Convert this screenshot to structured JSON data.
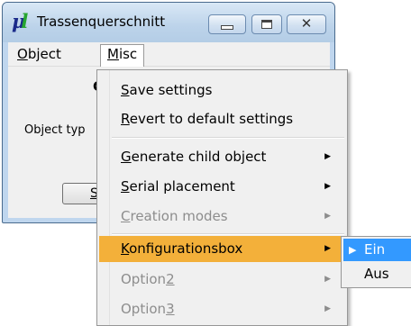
{
  "window": {
    "title": "Trassenquerschnitt",
    "controls": {
      "minimize_icon": "minimize-icon",
      "maximize_icon": "maximize-icon",
      "close_glyph": "✕"
    }
  },
  "menubar": {
    "items": [
      {
        "label": "Object"
      },
      {
        "label": "Misc"
      }
    ]
  },
  "client": {
    "partial_heading": "C",
    "object_type_label": "Object typ",
    "button_partial_label": "St"
  },
  "misc_menu": {
    "items": [
      {
        "label": "Save settings",
        "accel": "S",
        "has_submenu": false,
        "enabled": true
      },
      {
        "label": "Revert to default settings",
        "accel": "R",
        "has_submenu": false,
        "enabled": true
      },
      {
        "label": "Generate child object",
        "accel": "G",
        "has_submenu": true,
        "enabled": true
      },
      {
        "label": "Serial placement",
        "accel": "S",
        "has_submenu": true,
        "enabled": true
      },
      {
        "label": "Creation modes",
        "accel": "C",
        "has_submenu": true,
        "enabled": false
      },
      {
        "label": "Konfigurationsbox",
        "accel": "K",
        "has_submenu": true,
        "enabled": true,
        "highlighted": true
      },
      {
        "label": "Option2",
        "accel": "2",
        "has_submenu": true,
        "enabled": false
      },
      {
        "label": "Option3",
        "accel": "3",
        "has_submenu": true,
        "enabled": false
      }
    ],
    "arrow_glyph": "▶"
  },
  "submenu": {
    "items": [
      {
        "label": "Ein",
        "selected": true
      },
      {
        "label": "Aus",
        "selected": false
      }
    ],
    "selected_marker": "▶"
  },
  "colors": {
    "highlight": "#f3b03a",
    "submenu_active": "#3399ff",
    "disabled_text": "#8d8d8d",
    "window_frame": "#bfd6ee"
  }
}
